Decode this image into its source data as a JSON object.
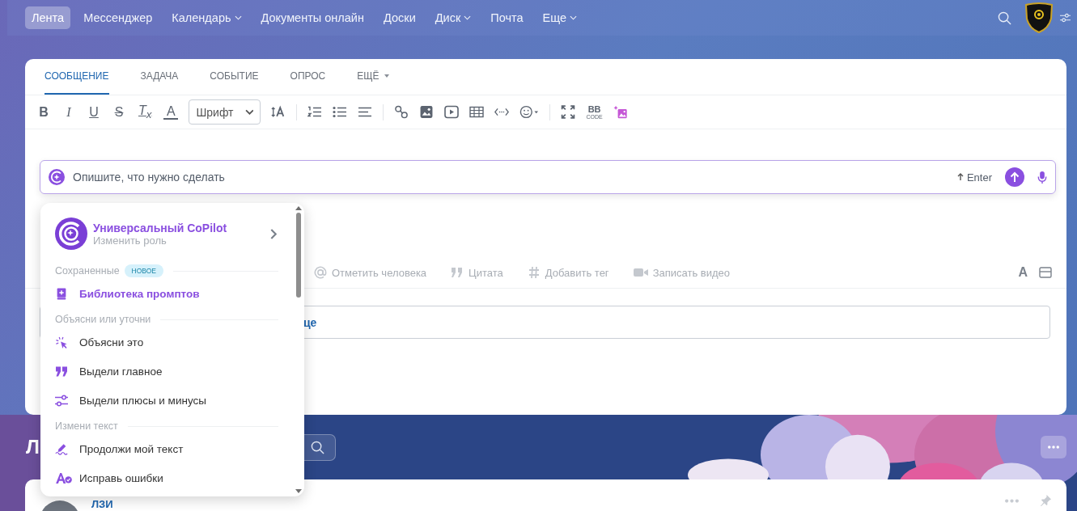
{
  "nav": {
    "items": [
      {
        "label": "Лента",
        "selected": true,
        "dropdown": false
      },
      {
        "label": "Мессенджер",
        "selected": false,
        "dropdown": false
      },
      {
        "label": "Календарь",
        "selected": false,
        "dropdown": true
      },
      {
        "label": "Документы онлайн",
        "selected": false,
        "dropdown": false
      },
      {
        "label": "Доски",
        "selected": false,
        "dropdown": false
      },
      {
        "label": "Диск",
        "selected": false,
        "dropdown": true
      },
      {
        "label": "Почта",
        "selected": false,
        "dropdown": false
      },
      {
        "label": "Еще",
        "selected": false,
        "dropdown": true
      }
    ]
  },
  "composer": {
    "tabs": [
      {
        "label": "СООБЩЕНИЕ",
        "selected": true,
        "dropdown": false
      },
      {
        "label": "ЗАДАЧА",
        "selected": false,
        "dropdown": false
      },
      {
        "label": "СОБЫТИЕ",
        "selected": false,
        "dropdown": false
      },
      {
        "label": "ОПРОС",
        "selected": false,
        "dropdown": false
      },
      {
        "label": "ЕЩЁ",
        "selected": false,
        "dropdown": true
      }
    ],
    "format_buttons": [
      {
        "label": "B",
        "kind": "bold"
      },
      {
        "label": "I",
        "kind": "italic"
      },
      {
        "label": "U",
        "kind": "underline"
      },
      {
        "label": "S",
        "kind": "strike"
      },
      {
        "label": "T$_{x}$",
        "kind": "clear"
      },
      {
        "label": "A",
        "kind": "color"
      }
    ],
    "font_select": "Шрифт",
    "bbcode": {
      "label": "BB",
      "sublabel": "CODE"
    },
    "copilot_input": {
      "placeholder": "Опишите, что нужно сделать",
      "hint": "Enter"
    },
    "actions": [
      "Отметить человека",
      "Цитата",
      "Добавить тег",
      "Записать видео"
    ],
    "text_toggle": "A",
    "field_text": "це"
  },
  "copilot_menu": {
    "title": "Универсальный CoPilot",
    "subtitle": "Изменить роль",
    "sections": [
      {
        "label": "Сохраненные",
        "badge": "НОВОЕ",
        "items": [
          {
            "label": "Библиотека промптов",
            "kind": "library"
          }
        ]
      },
      {
        "label": "Объясни или уточни",
        "items": [
          {
            "label": "Объясни это",
            "kind": "prompt"
          },
          {
            "label": "Выдели главное",
            "kind": "prompt"
          },
          {
            "label": "Выдели плюсы и минусы",
            "kind": "prompt"
          }
        ]
      },
      {
        "label": "Измени текст",
        "items": [
          {
            "label": "Продолжи мой текст",
            "kind": "prompt"
          },
          {
            "label": "Исправь ошибки",
            "kind": "prompt"
          }
        ]
      }
    ]
  },
  "feed": {
    "title": "Л"
  },
  "post": {
    "author": "ЛЗИ"
  }
}
